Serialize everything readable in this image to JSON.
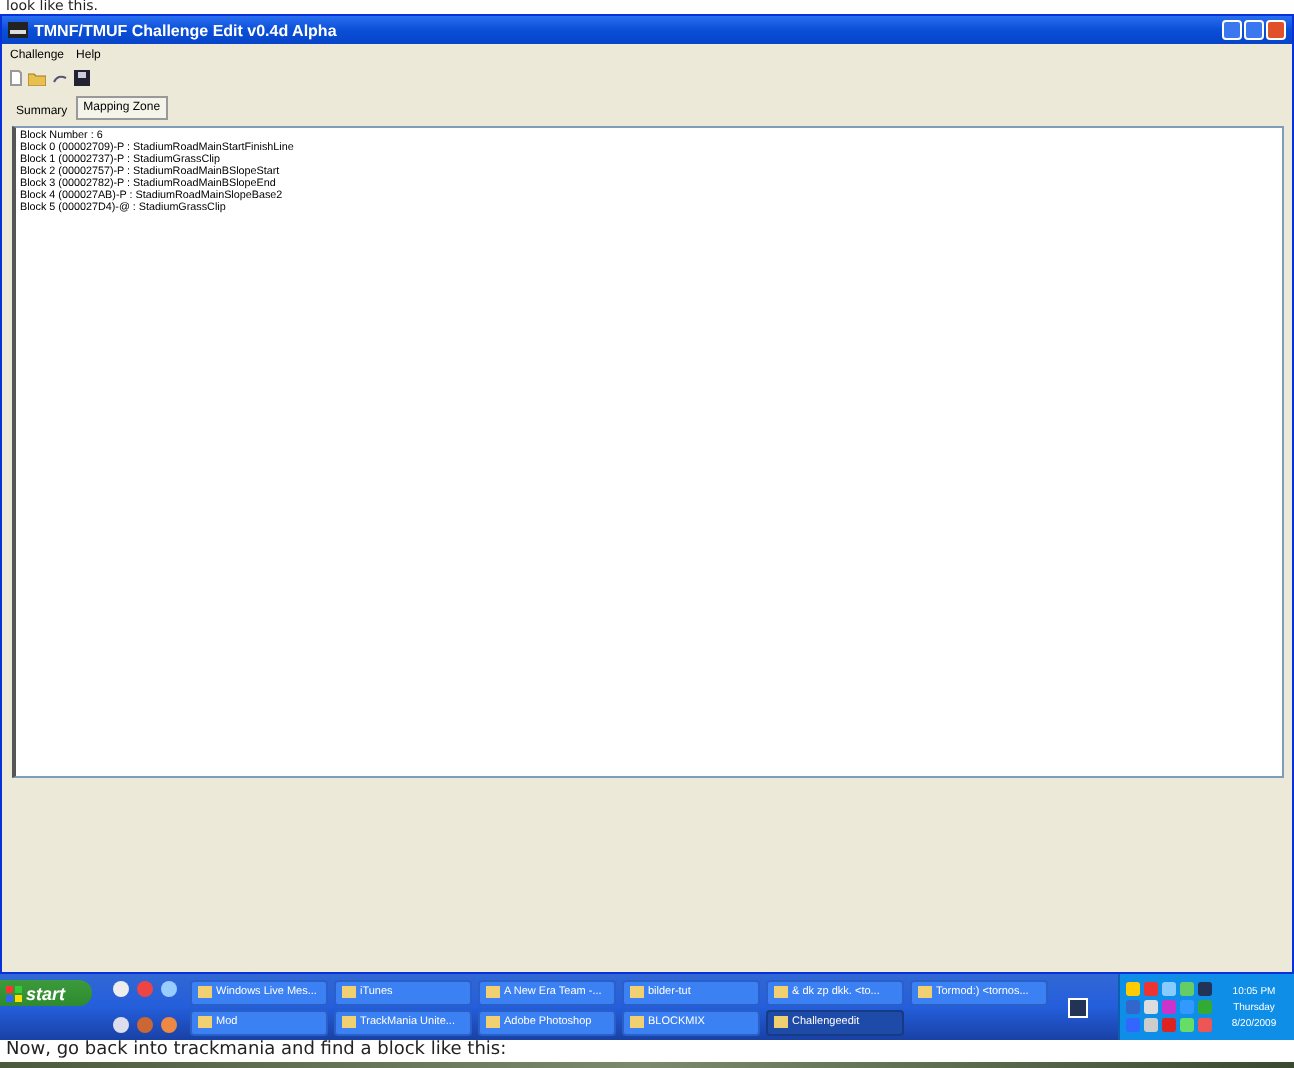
{
  "caption_top": "look like this.",
  "window": {
    "title": "TMNF/TMUF Challenge Edit v0.4d Alpha"
  },
  "menu": [
    "Challenge",
    "Help"
  ],
  "tabs": [
    {
      "label": "Summary",
      "selected": false
    },
    {
      "label": "Mapping Zone",
      "selected": true
    }
  ],
  "content_lines": [
    "Block Number : 6",
    "Block 0 (00002709)-P : StadiumRoadMainStartFinishLine",
    "Block 1 (00002737)-P : StadiumGrassClip",
    "Block 2 (00002757)-P : StadiumRoadMainBSlopeStart",
    "Block 3 (00002782)-P : StadiumRoadMainBSlopeEnd",
    "Block 4 (000027AB)-P : StadiumRoadMainSlopeBase2",
    "Block 5 (000027D4)-@ : StadiumGrassClip"
  ],
  "taskbar": {
    "start": "start",
    "buttons": [
      {
        "label": "Windows Live Mes...",
        "selected": false
      },
      {
        "label": "iTunes",
        "selected": false
      },
      {
        "label": "A New Era Team -...",
        "selected": false
      },
      {
        "label": "bilder-tut",
        "selected": false
      },
      {
        "label": "& dk zp dkk. <to...",
        "selected": false
      },
      {
        "label": "Tormod:) <tornos...",
        "selected": false
      },
      {
        "label": "Mod",
        "selected": false
      },
      {
        "label": "TrackMania Unite...",
        "selected": false
      },
      {
        "label": "Adobe Photoshop",
        "selected": false
      },
      {
        "label": "BLOCKMIX",
        "selected": false
      },
      {
        "label": "Challengeedit",
        "selected": true
      }
    ],
    "clock": [
      "10:05 PM",
      "Thursday",
      "8/20/2009"
    ]
  },
  "caption_bottom": "Now, go back into trackmania and find a block like this:"
}
